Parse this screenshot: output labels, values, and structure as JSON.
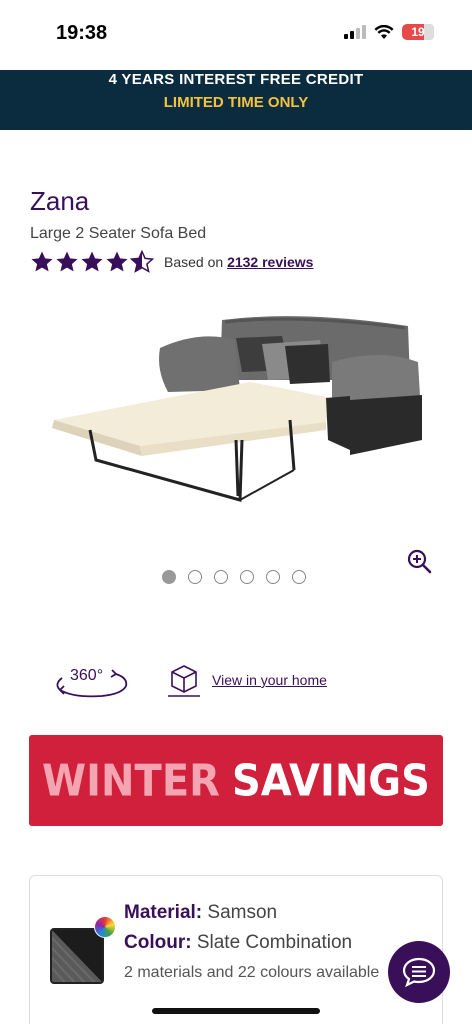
{
  "status_bar": {
    "time": "19:38",
    "battery": "19"
  },
  "banner": {
    "line1": "4 YEARS INTEREST FREE CREDIT",
    "line2": "LIMITED TIME ONLY"
  },
  "product": {
    "name": "Zana",
    "subtitle": "Large 2 Seater Sofa Bed",
    "rating_value": 4.5,
    "rating_prefix": "Based on",
    "reviews_link": "2132 reviews",
    "image_icon": "sofa-bed-image",
    "gallery_count": 6,
    "gallery_active": 1
  },
  "actions": {
    "view_360_label": "360°",
    "view_in_home": "View in your home"
  },
  "promo": {
    "word1": "WINTER",
    "word2": "SAVINGS",
    "bg_color": "#d0203c"
  },
  "options": {
    "material_label": "Material:",
    "material_value": "Samson",
    "colour_label": "Colour:",
    "colour_value": "Slate Combination",
    "more_text": "2 materials and 22 colours available"
  },
  "colors": {
    "brand": "#3a0f5a",
    "banner_bg": "#0b2c3f",
    "banner_accent": "#f3c33f"
  }
}
